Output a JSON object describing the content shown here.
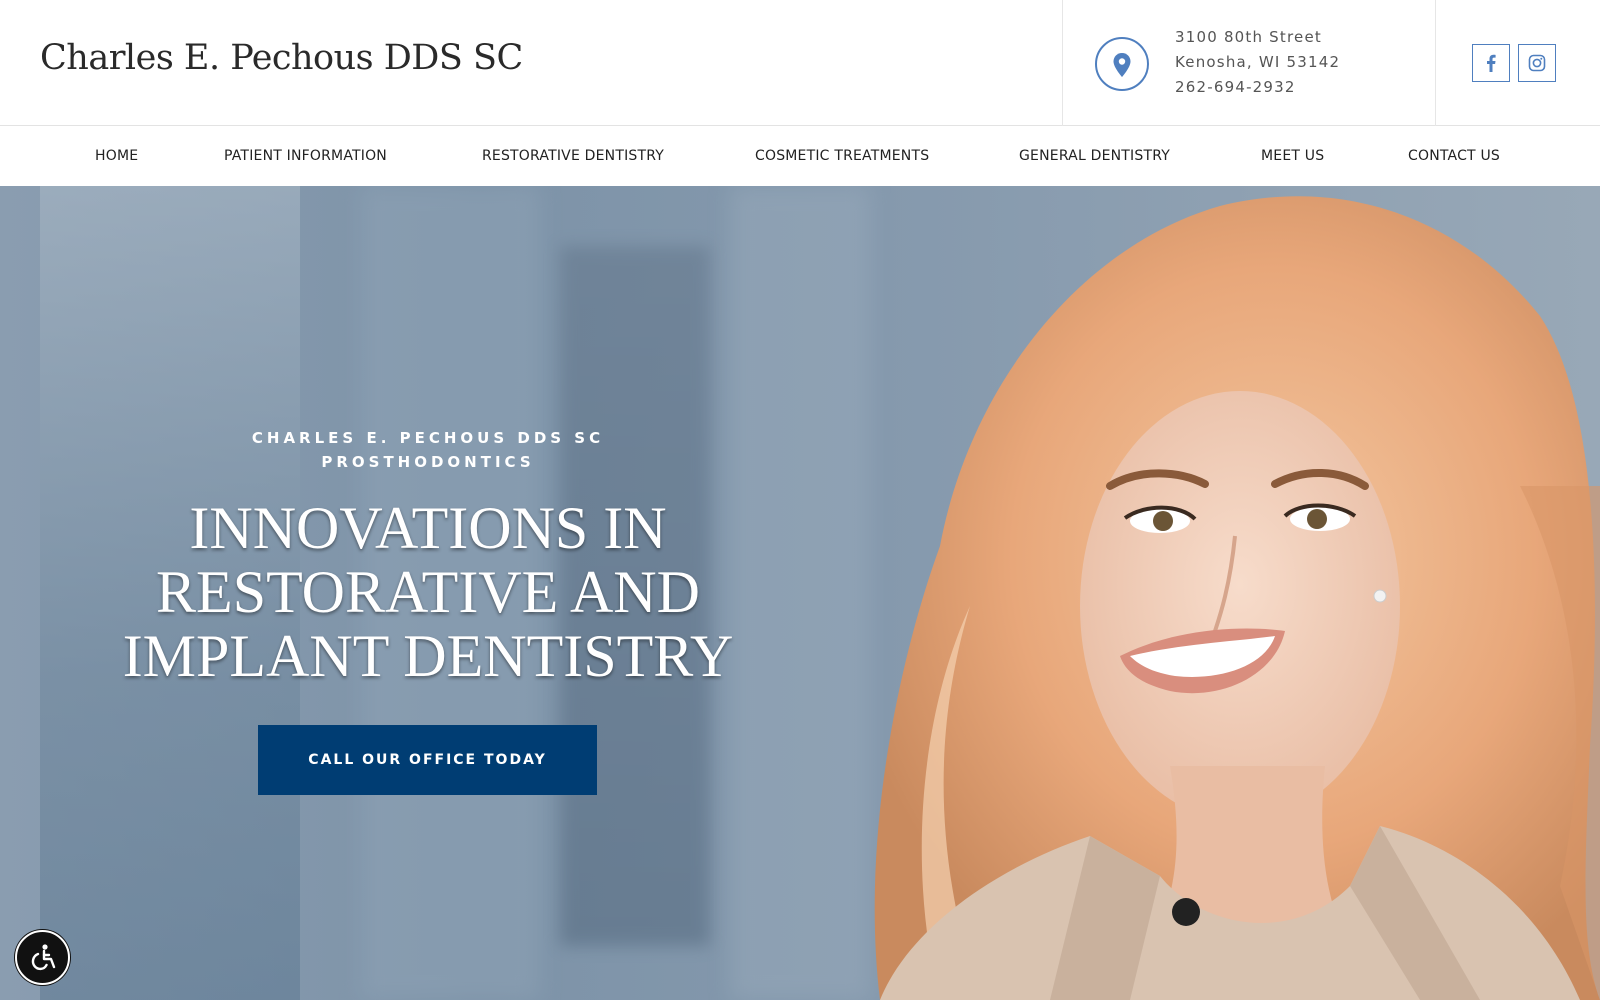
{
  "header": {
    "logo": "Charles E. Pechous DDS SC",
    "address_line1": "3100 80th Street",
    "address_line2": "Kenosha, WI 53142",
    "phone": "262-694-2932",
    "icons": {
      "location": "map-pin-icon",
      "facebook": "facebook-icon",
      "instagram": "instagram-icon"
    },
    "accent_color": "#4f7fbf"
  },
  "nav": {
    "items": [
      {
        "label": "HOME"
      },
      {
        "label": "PATIENT INFORMATION"
      },
      {
        "label": "RESTORATIVE DENTISTRY"
      },
      {
        "label": "COSMETIC TREATMENTS"
      },
      {
        "label": "GENERAL DENTISTRY"
      },
      {
        "label": "MEET US"
      },
      {
        "label": "CONTACT US"
      }
    ]
  },
  "hero": {
    "subtitle_line1": "CHARLES E. PECHOUS DDS SC",
    "subtitle_line2": "PROSTHODONTICS",
    "headline_line1": "INNOVATIONS IN",
    "headline_line2": "RESTORATIVE AND",
    "headline_line3": "IMPLANT DENTISTRY",
    "cta_label": "CALL OUR OFFICE TODAY",
    "cta_color": "#003d73"
  },
  "accessibility": {
    "icon": "wheelchair-icon"
  }
}
